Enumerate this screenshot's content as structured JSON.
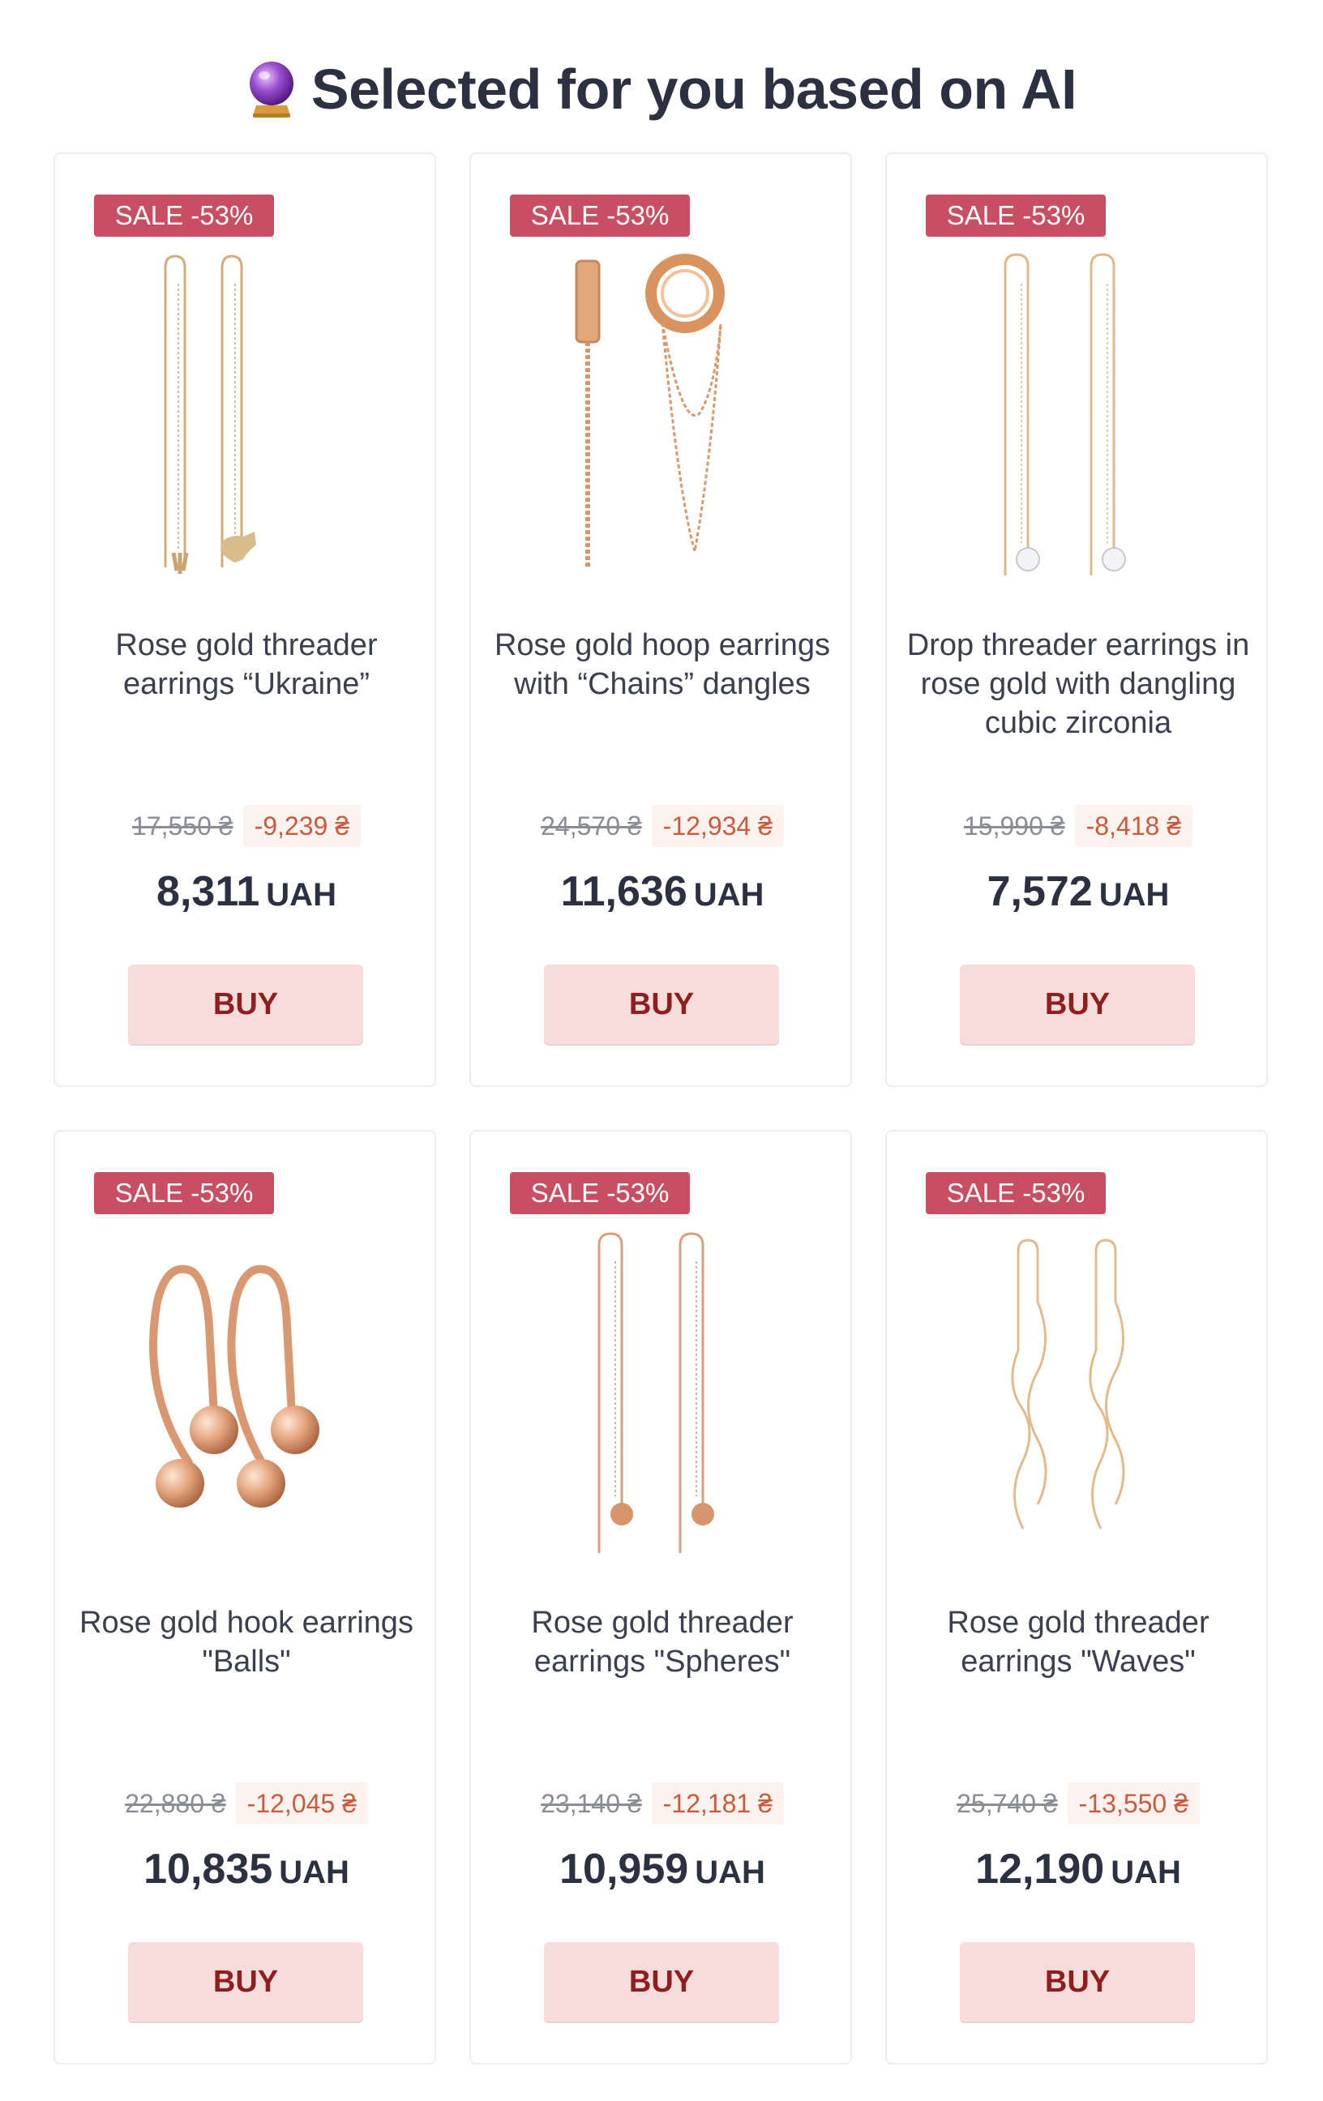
{
  "section": {
    "title": "Selected for you based on AI",
    "icon": "crystal-ball-icon"
  },
  "colors": {
    "badge": "#c84f61",
    "buy_button_bg": "#f8dcdc",
    "buy_button_text": "#8d1f1f",
    "discount": "#c85a3f"
  },
  "products": [
    {
      "badge": "SALE -53%",
      "name": "Rose gold threader earrings “Ukraine”",
      "image_icon": "threader-earrings-ukraine-image",
      "old_price": "17,550 ₴",
      "discount": "-9,239 ₴",
      "price": "8,311",
      "currency": "UAH",
      "buy_label": "BUY"
    },
    {
      "badge": "SALE -53%",
      "name": "Rose gold hoop earrings with “Chains” dangles",
      "image_icon": "hoop-earrings-chains-image",
      "old_price": "24,570 ₴",
      "discount": "-12,934 ₴",
      "price": "11,636",
      "currency": "UAH",
      "buy_label": "BUY"
    },
    {
      "badge": "SALE -53%",
      "name": "Drop threader earrings in rose gold with dangling cubic zirconia",
      "image_icon": "drop-threader-earrings-zirconia-image",
      "old_price": "15,990 ₴",
      "discount": "-8,418 ₴",
      "price": "7,572",
      "currency": "UAH",
      "buy_label": "BUY"
    },
    {
      "badge": "SALE -53%",
      "name": "Rose gold hook earrings \"Balls\"",
      "image_icon": "hook-earrings-balls-image",
      "old_price": "22,880 ₴",
      "discount": "-12,045 ₴",
      "price": "10,835",
      "currency": "UAH",
      "buy_label": "BUY"
    },
    {
      "badge": "SALE -53%",
      "name": "Rose gold threader earrings \"Spheres\"",
      "image_icon": "threader-earrings-spheres-image",
      "old_price": "23,140 ₴",
      "discount": "-12,181 ₴",
      "price": "10,959",
      "currency": "UAH",
      "buy_label": "BUY"
    },
    {
      "badge": "SALE -53%",
      "name": "Rose gold threader earrings \"Waves\"",
      "image_icon": "threader-earrings-waves-image",
      "old_price": "25,740 ₴",
      "discount": "-13,550 ₴",
      "price": "12,190",
      "currency": "UAH",
      "buy_label": "BUY"
    }
  ]
}
